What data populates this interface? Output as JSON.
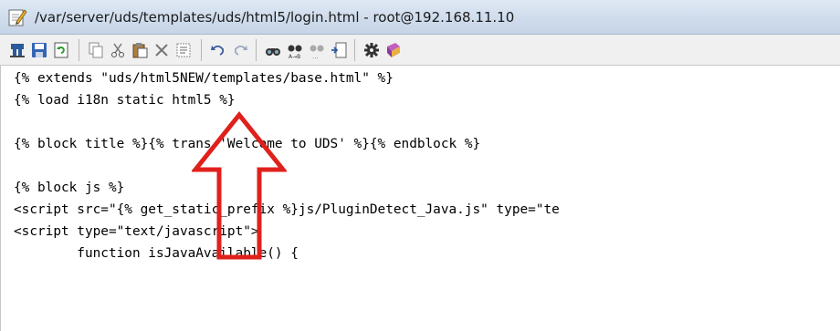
{
  "window": {
    "title": "/var/server/uds/templates/uds/html5/login.html - root@192.168.11.10"
  },
  "toolbar": {
    "buttons": [
      "upload-icon",
      "save-icon",
      "refresh-icon",
      "copy-icon",
      "cut-icon",
      "paste-icon",
      "delete-icon",
      "select-all-icon",
      "undo-icon",
      "redo-icon",
      "find-icon",
      "replace-icon",
      "find-next-icon",
      "go-to-icon",
      "settings-icon",
      "help-icon"
    ]
  },
  "editor": {
    "lines": [
      "{% extends \"uds/html5NEW/templates/base.html\" %}",
      "{% load i18n static html5 %}",
      "",
      "{% block title %}{% trans 'Welcome to UDS' %}{% endblock %}",
      "",
      "{% block js %}",
      "<script src=\"{% get_static_prefix %}js/PluginDetect_Java.js\" type=\"te",
      "<script type=\"text/javascript\">",
      "        function isJavaAvailable() {"
    ]
  },
  "annotation": {
    "arrow_color": "#e0201c"
  }
}
